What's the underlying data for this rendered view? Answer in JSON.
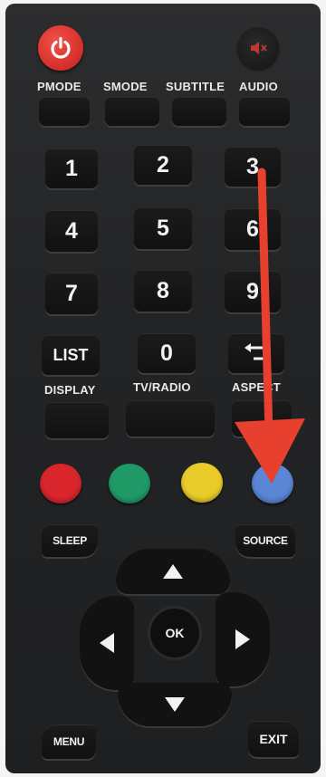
{
  "top_labels": [
    "PMODE",
    "SMODE",
    "SUBTITLE",
    "AUDIO"
  ],
  "digits": [
    "1",
    "2",
    "3",
    "4",
    "5",
    "6",
    "7",
    "8",
    "9"
  ],
  "row5": {
    "list": "LIST",
    "zero": "0"
  },
  "lower_labels": [
    "DISPLAY",
    "TV/RADIO",
    "ASPECT"
  ],
  "color_buttons": [
    {
      "name": "red",
      "color": "#d8262c"
    },
    {
      "name": "green",
      "color": "#1f9a67"
    },
    {
      "name": "yellow",
      "color": "#e9cc2a"
    },
    {
      "name": "blue",
      "color": "#5b86d6"
    }
  ],
  "sleep": "SLEEP",
  "source": "SOURCE",
  "ok": "OK",
  "menu": "MENU",
  "exit": "EXIT",
  "colors": {
    "power": "#e0332c",
    "arrow": "#e8402e",
    "remote_body": "#252628"
  },
  "icons": [
    "power-icon",
    "mute-icon",
    "return-icon",
    "up-arrow-icon",
    "down-arrow-icon",
    "left-arrow-icon",
    "right-arrow-icon"
  ]
}
